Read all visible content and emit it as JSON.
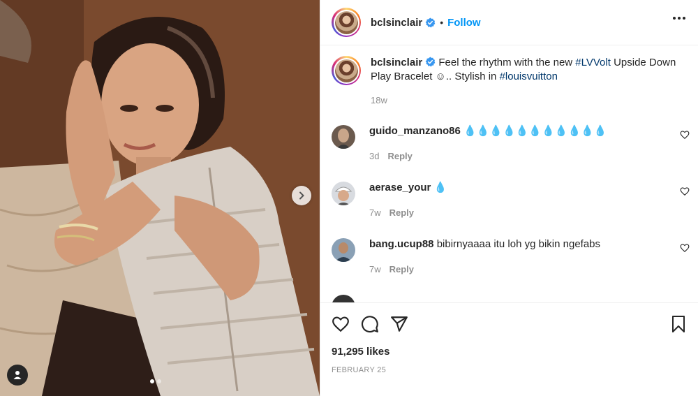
{
  "header": {
    "username": "bclsinclair",
    "verified": true,
    "separator": "•",
    "follow_label": "Follow",
    "more_icon": "more-options-icon"
  },
  "caption": {
    "username": "bclsinclair",
    "text_1": " Feel the rhythm with the new ",
    "hashtag_1": "#LVVolt",
    "text_2": " Upside Down Play Bracelet ☺.. Stylish in ",
    "hashtag_2": "#louisvuitton",
    "time": "18w"
  },
  "comments": [
    {
      "username": "guido_manzano86",
      "text": "💧💧💧💧💧💧💧💧💧💧💧",
      "time": "3d",
      "reply_label": "Reply"
    },
    {
      "username": "aerase_your",
      "text": "💧",
      "time": "7w",
      "reply_label": "Reply"
    },
    {
      "username": "bang.ucup88",
      "text": "bibirnyaaaa itu loh yg bikin ngefabs",
      "time": "7w",
      "reply_label": "Reply"
    }
  ],
  "actions": {
    "like_icon": "heart-icon",
    "comment_icon": "comment-icon",
    "share_icon": "share-icon",
    "save_icon": "bookmark-icon"
  },
  "likes": "91,295 likes",
  "date": "FEBRUARY 25",
  "carousel": {
    "current": 1,
    "total": 2
  },
  "colors": {
    "accent": "#0095f6",
    "hashtag": "#00376b",
    "muted": "#8e8e8e",
    "text": "#262626"
  }
}
